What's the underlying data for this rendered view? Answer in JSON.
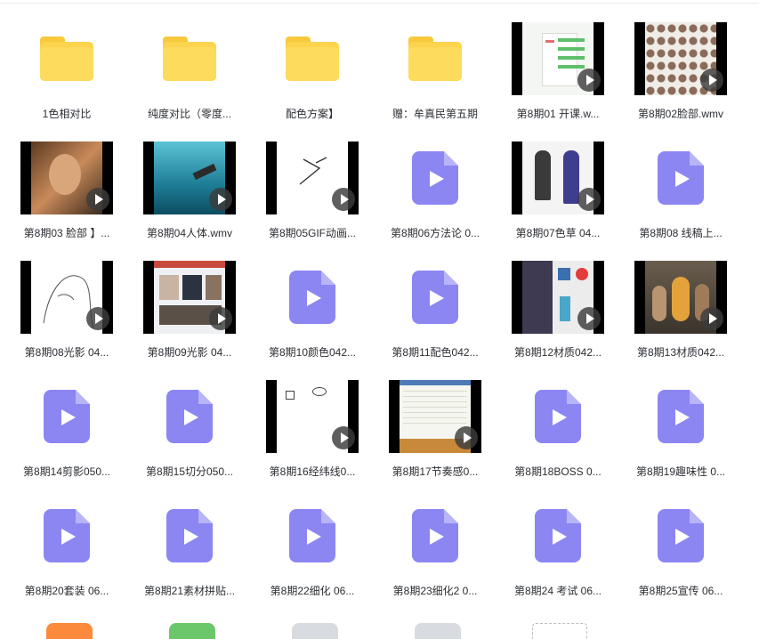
{
  "files": [
    {
      "label": "1色相对比",
      "kind": "folder"
    },
    {
      "label": "纯度对比（零度...",
      "kind": "folder"
    },
    {
      "label": "配色方案】",
      "kind": "folder"
    },
    {
      "label": "赠：牟真民第五期",
      "kind": "folder"
    },
    {
      "label": "第8期01 开课.w...",
      "kind": "video-thumb",
      "thumb": "table"
    },
    {
      "label": "第8期02脸部.wmv",
      "kind": "video-thumb",
      "thumb": "faces"
    },
    {
      "label": "第8期03 脸部 】...",
      "kind": "video-thumb",
      "thumb": "portrait"
    },
    {
      "label": "第8期04人体.wmv",
      "kind": "video-thumb",
      "thumb": "ocean"
    },
    {
      "label": "第8期05GIF动画...",
      "kind": "video-thumb",
      "thumb": "sketch"
    },
    {
      "label": "第8期06方法论 0...",
      "kind": "video-file"
    },
    {
      "label": "第8期07色草 04...",
      "kind": "video-thumb",
      "thumb": "figures"
    },
    {
      "label": "第8期08 线稿上...",
      "kind": "video-file"
    },
    {
      "label": "第8期08光影 04...",
      "kind": "video-thumb",
      "thumb": "lineart"
    },
    {
      "label": "第8期09光影 04...",
      "kind": "video-thumb",
      "thumb": "browser"
    },
    {
      "label": "第8期10颜色042...",
      "kind": "video-file"
    },
    {
      "label": "第8期11配色042...",
      "kind": "video-file"
    },
    {
      "label": "第8期12材质042...",
      "kind": "video-thumb",
      "thumb": "materials"
    },
    {
      "label": "第8期13材质042...",
      "kind": "video-thumb",
      "thumb": "statues"
    },
    {
      "label": "第8期14剪影050...",
      "kind": "video-file"
    },
    {
      "label": "第8期15切分050...",
      "kind": "video-file"
    },
    {
      "label": "第8期16经纬线0...",
      "kind": "video-thumb",
      "thumb": "notes"
    },
    {
      "label": "第8期17节奏感0...",
      "kind": "video-thumb",
      "thumb": "spreadsheet"
    },
    {
      "label": "第8期18BOSS 0...",
      "kind": "video-file"
    },
    {
      "label": "第8期19趣味性 0...",
      "kind": "video-file"
    },
    {
      "label": "第8期20套装 06...",
      "kind": "video-file"
    },
    {
      "label": "第8期21素材拼贴...",
      "kind": "video-file"
    },
    {
      "label": "第8期22细化 06...",
      "kind": "video-file"
    },
    {
      "label": "第8期23细化2 0...",
      "kind": "video-file"
    },
    {
      "label": "第8期24 考试 06...",
      "kind": "video-file"
    },
    {
      "label": "第8期25宣传 06...",
      "kind": "video-file"
    }
  ],
  "partial_row": [
    {
      "kind": "orange-file",
      "color": "#fb8a3c"
    },
    {
      "kind": "green-file",
      "color": "#6cc76a"
    },
    {
      "kind": "gray-file",
      "color": "#d8dbe0"
    },
    {
      "kind": "gray-file",
      "color": "#d8dbe0"
    },
    {
      "kind": "blank",
      "color": "#ffffff"
    },
    {
      "kind": "dashed-placeholder",
      "color": "#b9bec7"
    }
  ],
  "colors": {
    "folder": "#fcd44e",
    "video_file": "#8c86f3",
    "label_text": "#2b2e33"
  }
}
